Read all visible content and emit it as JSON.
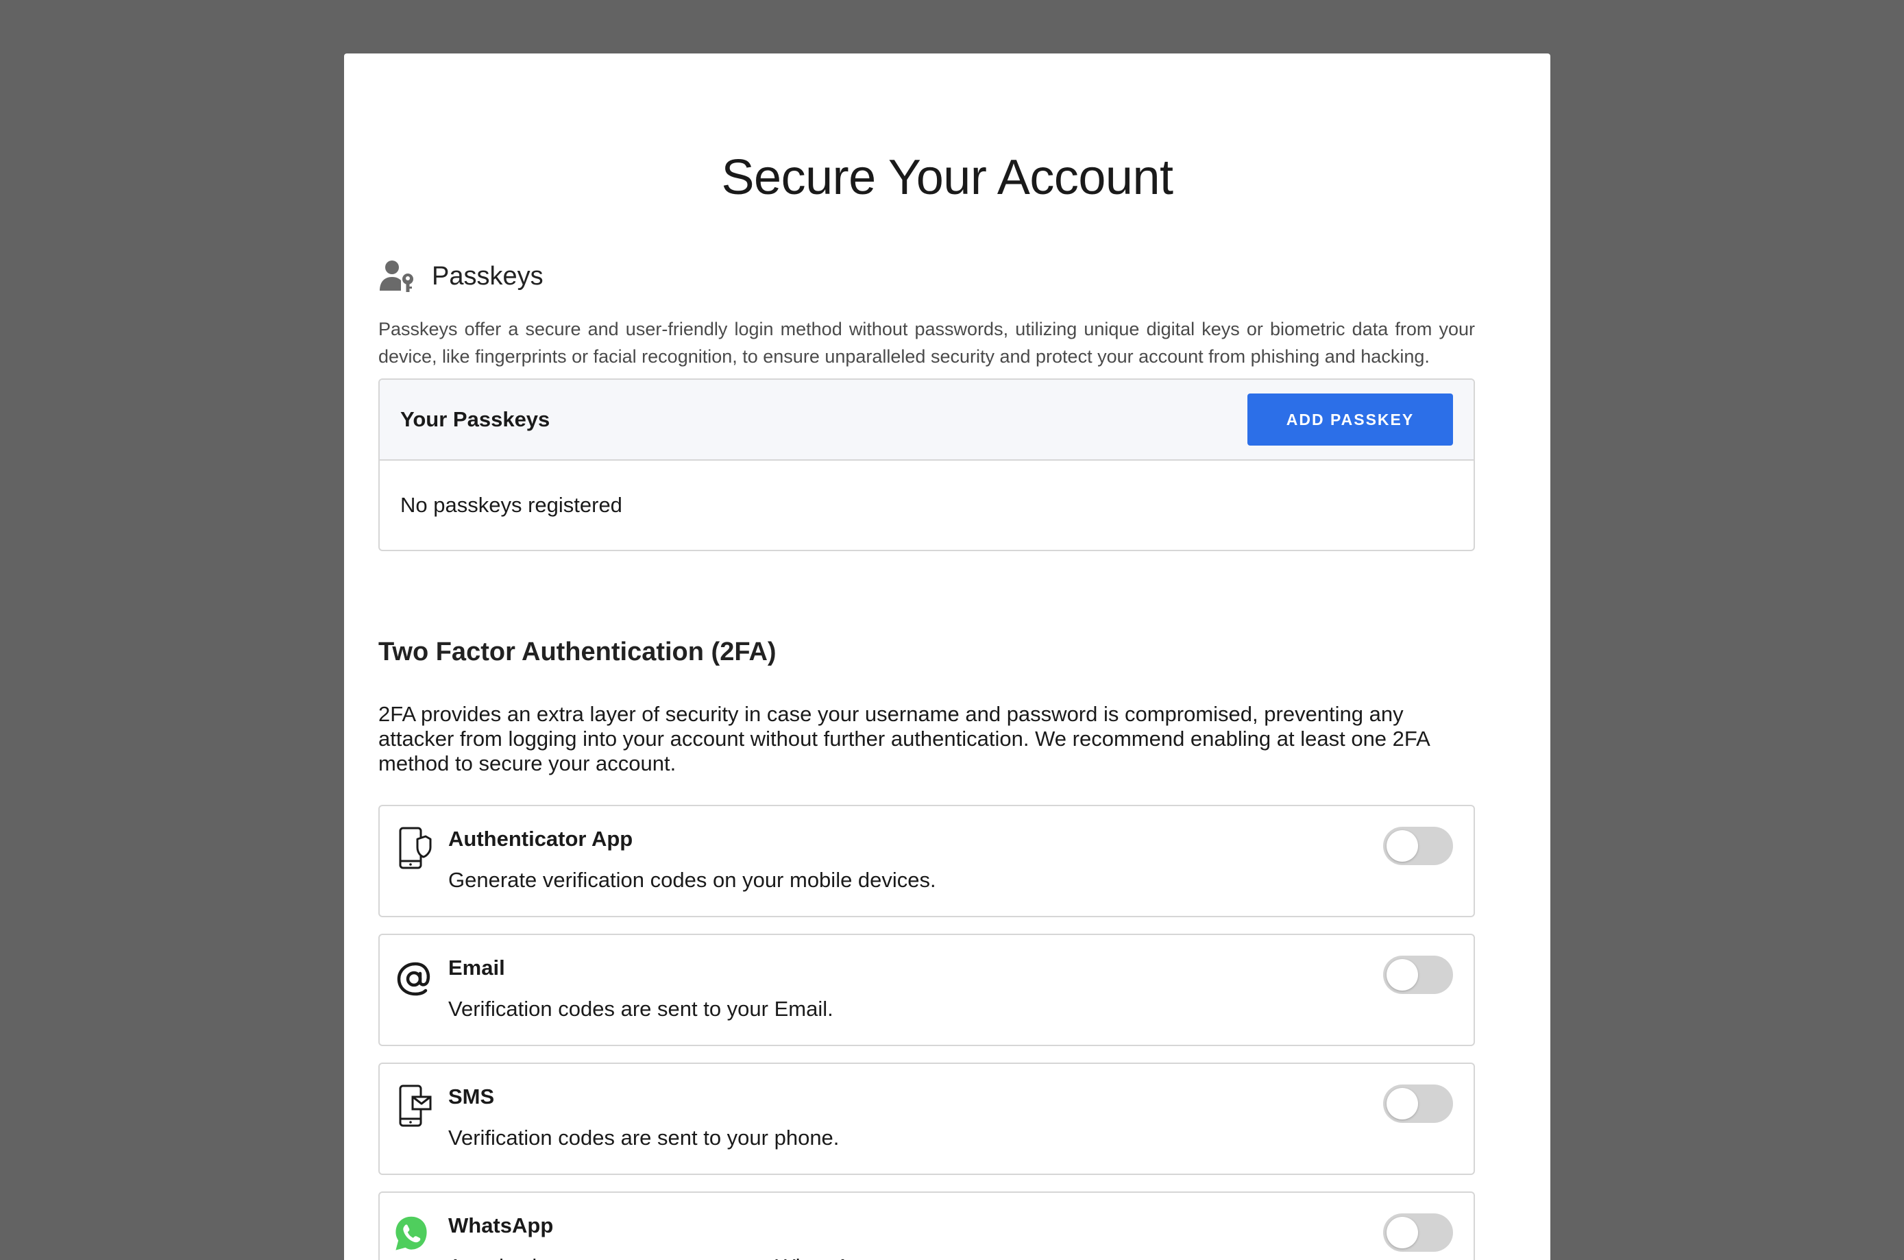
{
  "page": {
    "title": "Secure Your Account",
    "background_color": "#636363",
    "card_color": "#ffffff"
  },
  "passkeys": {
    "icon": "user-key-icon",
    "heading": "Passkeys",
    "description": "Passkeys offer a secure and user-friendly login method without passwords, utilizing unique digital keys or biometric data from your device, like fingerprints or facial recognition, to ensure unparalleled security and protect your account from phishing and hacking.",
    "list_heading": "Your Passkeys",
    "add_button_label": "ADD PASSKEY",
    "add_button_color": "#2c6fe8",
    "empty_text": "No passkeys registered"
  },
  "two_factor": {
    "heading": "Two Factor Authentication (2FA)",
    "description": "2FA provides an extra layer of security in case your username and password is compromised, preventing any attacker from logging into your account without further authentication. We recommend enabling at least one 2FA method to secure your account.",
    "methods": [
      {
        "icon": "phone-shield-icon",
        "title": "Authenticator App",
        "subtitle": "Generate verification codes on your mobile devices.",
        "enabled": false
      },
      {
        "icon": "at-sign-icon",
        "title": "Email",
        "subtitle": "Verification codes are sent to your Email.",
        "enabled": false
      },
      {
        "icon": "phone-message-icon",
        "title": "SMS",
        "subtitle": "Verification codes are sent to your phone.",
        "enabled": false
      },
      {
        "icon": "whatsapp-icon",
        "title": "WhatsApp",
        "subtitle": "Autorization message sent to your WhatsApp account.",
        "enabled": false,
        "icon_color": "#4fce5d"
      }
    ]
  }
}
